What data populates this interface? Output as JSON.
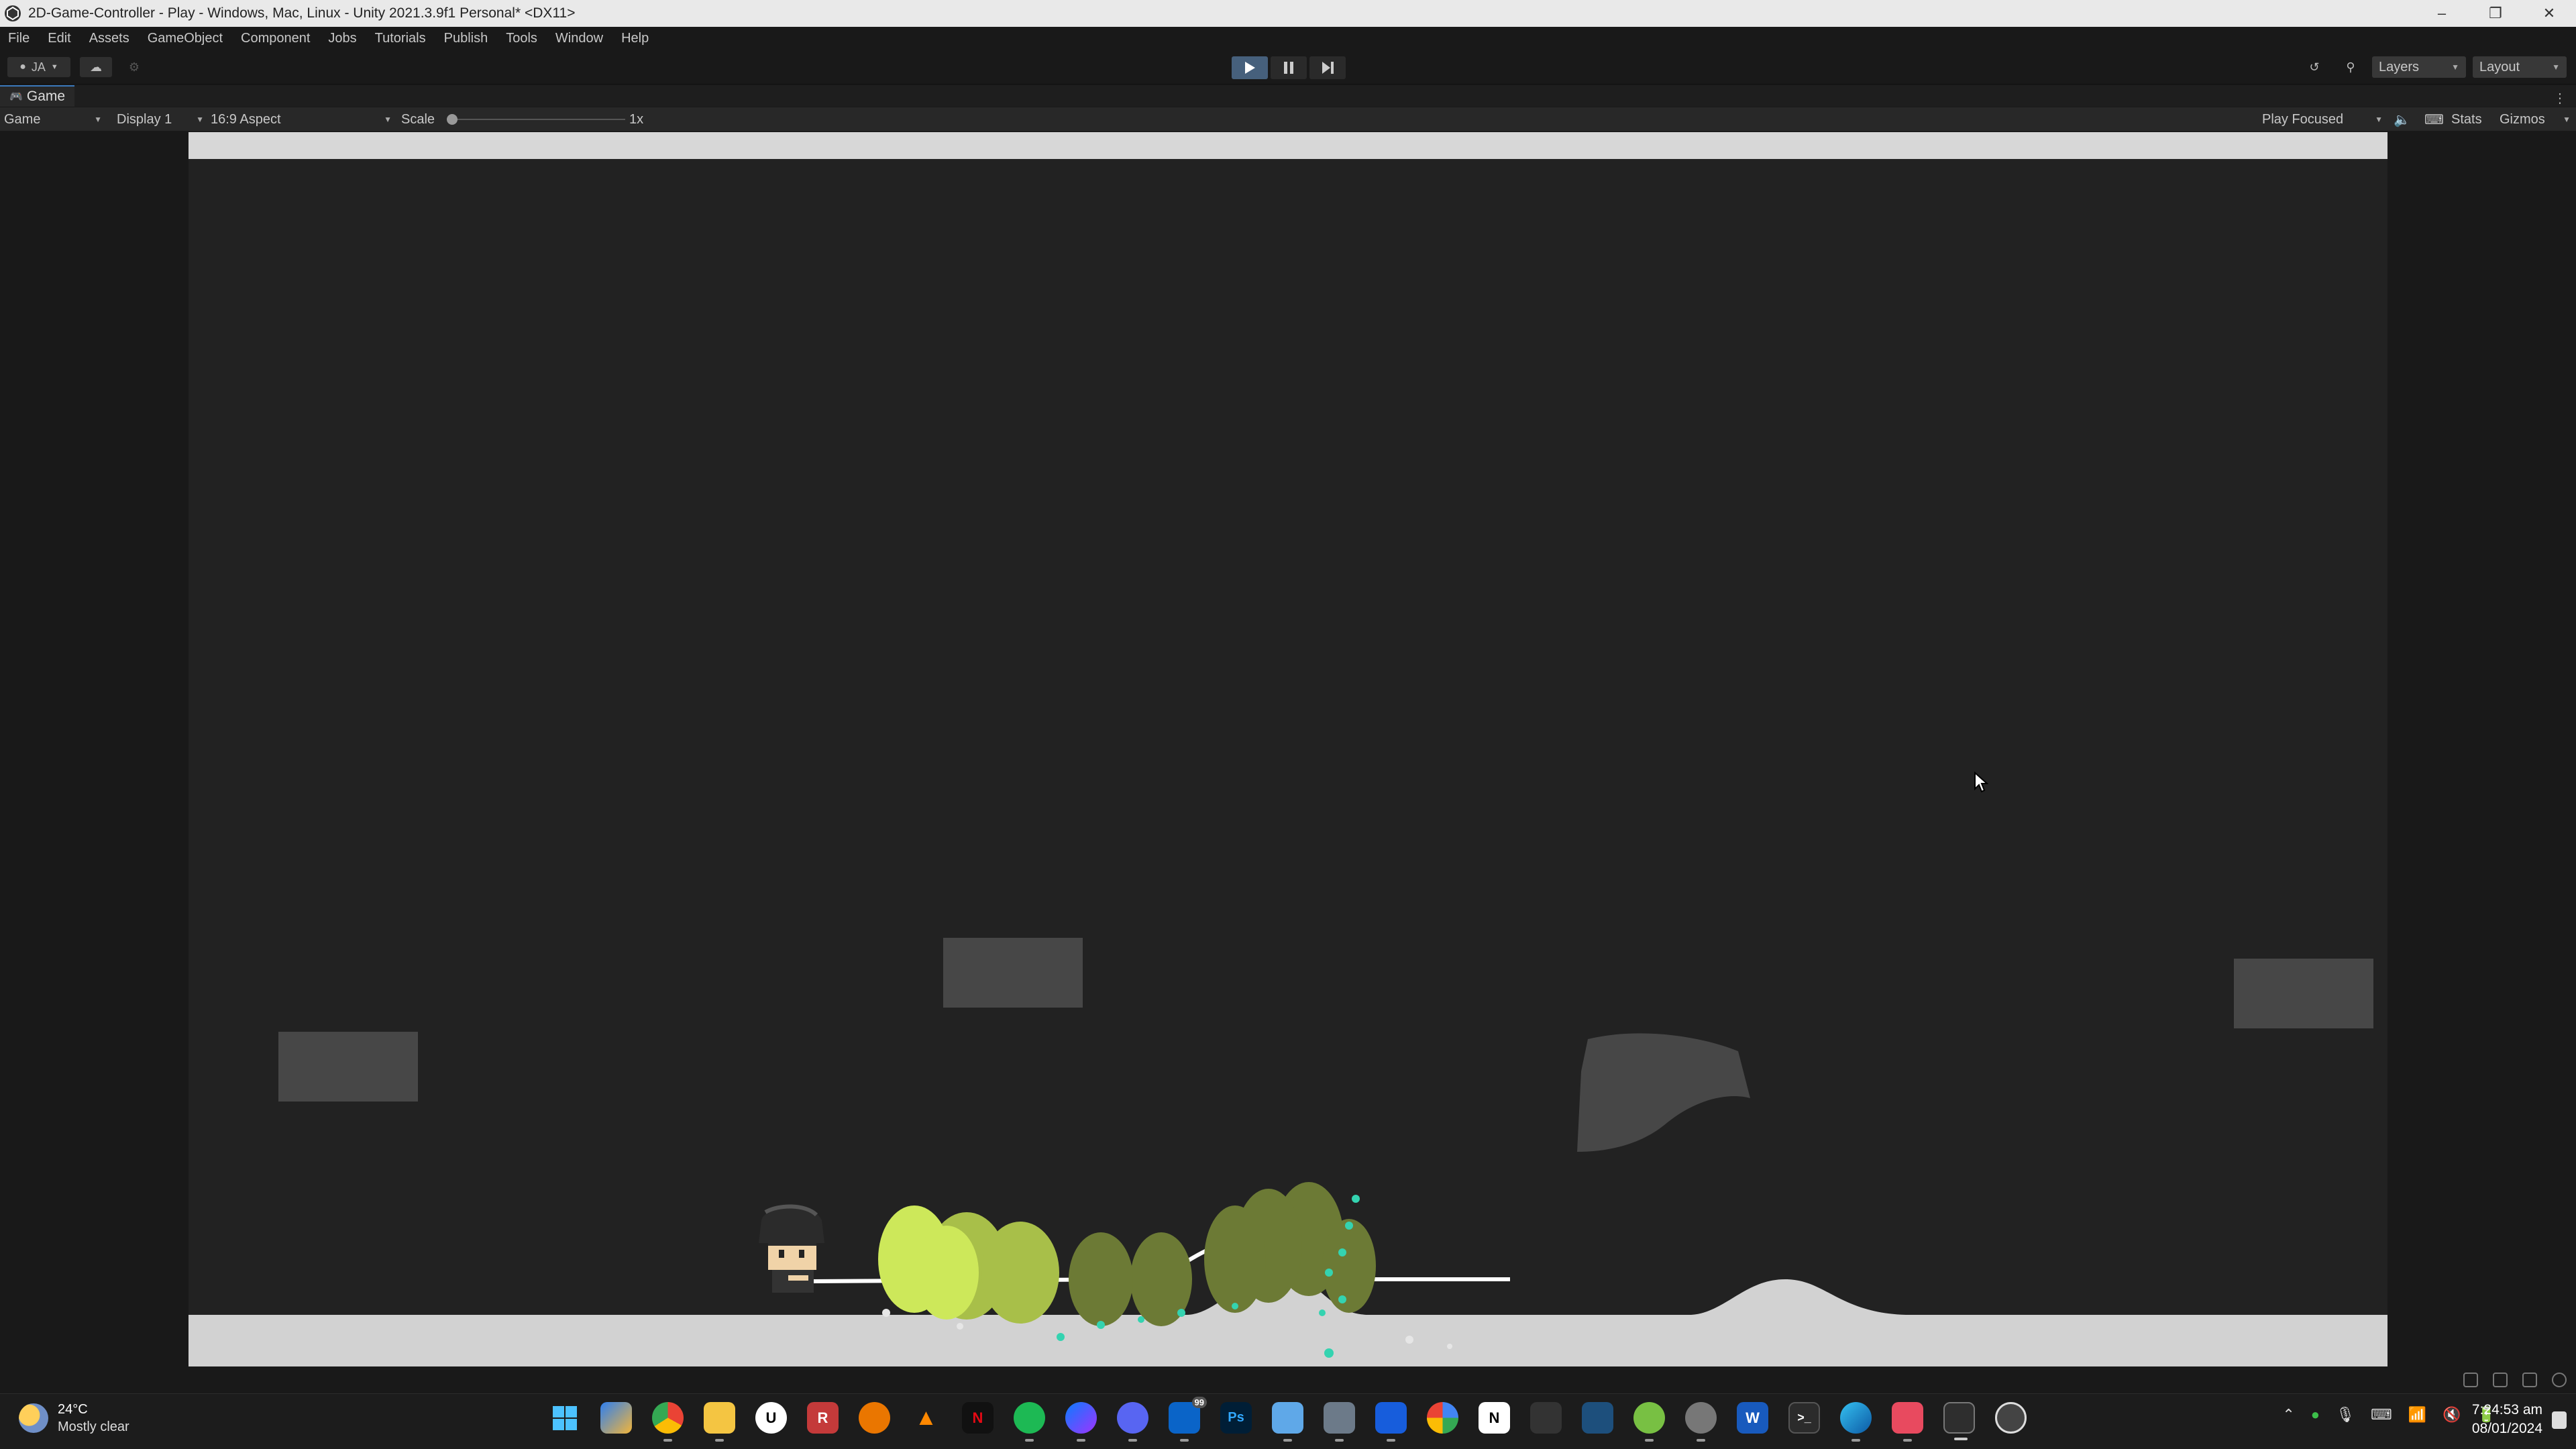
{
  "window": {
    "title": "2D-Game-Controller - Play - Windows, Mac, Linux - Unity 2021.3.9f1 Personal* <DX11>",
    "controls": [
      "minimize",
      "restore",
      "close"
    ]
  },
  "menu": [
    "File",
    "Edit",
    "Assets",
    "GameObject",
    "Component",
    "Jobs",
    "Tutorials",
    "Publish",
    "Tools",
    "Window",
    "Help"
  ],
  "toolbar": {
    "account": "JA",
    "play_state": "playing",
    "right": {
      "layers": "Layers",
      "layout": "Layout"
    }
  },
  "game_tab": {
    "label": "Game",
    "mode": "Game",
    "display": "Display 1",
    "aspect": "16:9 Aspect",
    "scale_label": "Scale",
    "scale_value": "1x",
    "play_mode": "Play Focused",
    "stats": "Stats",
    "gizmos": "Gizmos"
  },
  "scene": {
    "background_color": "#222222",
    "ground_color": "#d2d2d2",
    "platform_color": "#474747",
    "effect_colors": [
      "#cde85a",
      "#6c7a35",
      "#34d3b0"
    ]
  },
  "taskbar": {
    "weather": {
      "temp": "24°C",
      "condition": "Mostly clear"
    },
    "apps": [
      "start",
      "widgets",
      "chrome",
      "file-explorer",
      "unreal",
      "app-r",
      "blender",
      "vlc",
      "netflix",
      "spotify",
      "messenger",
      "discord",
      "outlook",
      "photoshop",
      "notepad",
      "calculator",
      "bitwarden",
      "google",
      "notion",
      "unity-hub",
      "task-manager",
      "utorrent",
      "settings",
      "word",
      "terminal",
      "edge",
      "snipping",
      "unity",
      "app-extra"
    ],
    "outlook_badge": "99",
    "clock": {
      "time": "7:24:53 am",
      "date": "08/01/2024"
    }
  }
}
